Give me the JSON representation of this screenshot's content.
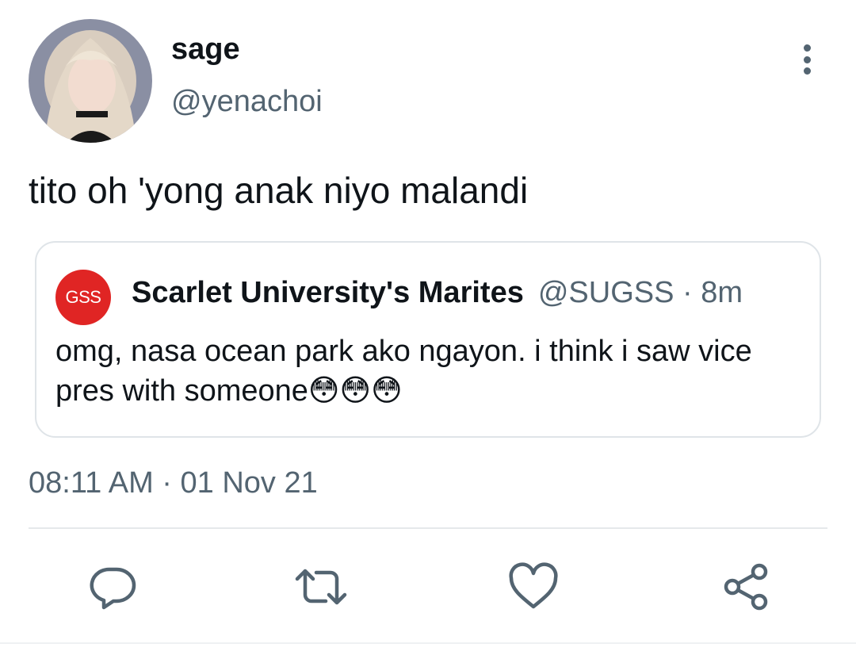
{
  "tweet": {
    "display_name": "sage",
    "handle": "@yenachoi",
    "text": "tito oh 'yong anak niyo malandi",
    "timestamp": "08:11 AM · 01 Nov 21"
  },
  "quoted_tweet": {
    "avatar_text": "GSS",
    "display_name": "Scarlet University's Marites",
    "meta": "@SUGSS · 8m",
    "text": "omg, nasa ocean park ako ngayon. i think i saw vice pres with someone😳😳😳"
  },
  "icons": {
    "more": "more-vertical-icon",
    "reply": "reply-icon",
    "retweet": "retweet-icon",
    "like": "heart-icon",
    "share": "share-icon"
  },
  "colors": {
    "text_primary": "#0f1419",
    "text_secondary": "#536471",
    "quote_avatar_bg": "#e02524",
    "border": "#dfe4e8"
  }
}
